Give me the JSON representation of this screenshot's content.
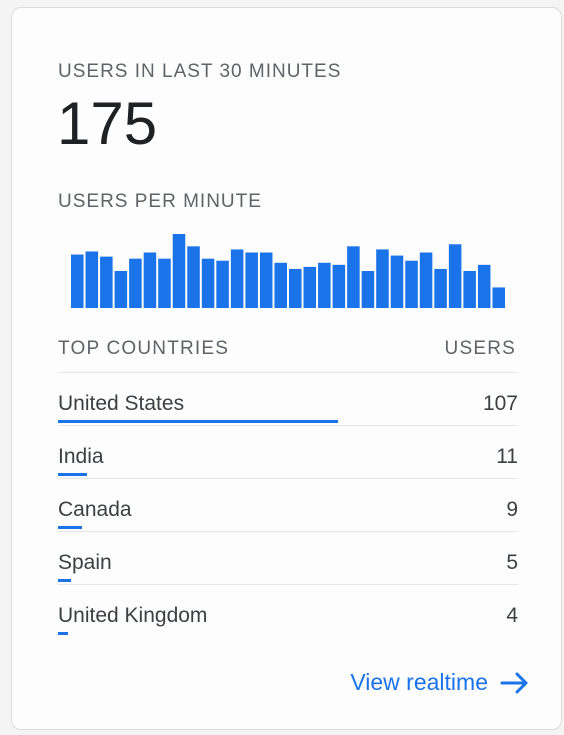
{
  "users_heading": "USERS IN LAST 30 MINUTES",
  "users_total": "175",
  "per_minute_heading": "USERS PER MINUTE",
  "chart_data": {
    "type": "bar",
    "xlabel": "",
    "ylabel": "",
    "values": [
      52,
      55,
      50,
      36,
      48,
      54,
      48,
      72,
      60,
      48,
      46,
      57,
      54,
      54,
      44,
      38,
      40,
      44,
      42,
      60,
      36,
      57,
      51,
      46,
      54,
      38,
      62,
      36,
      42,
      20
    ],
    "color": "#1a73e8"
  },
  "table": {
    "col_left": "TOP COUNTRIES",
    "col_right": "USERS",
    "max": 107,
    "rows": [
      {
        "country": "United States",
        "users": "107",
        "value": 107
      },
      {
        "country": "India",
        "users": "11",
        "value": 11
      },
      {
        "country": "Canada",
        "users": "9",
        "value": 9
      },
      {
        "country": "Spain",
        "users": "5",
        "value": 5
      },
      {
        "country": "United Kingdom",
        "users": "4",
        "value": 4
      }
    ]
  },
  "link": {
    "label": "View realtime",
    "icon": "arrow-right-icon"
  },
  "colors": {
    "accent": "#1a73e8",
    "text": "#3c4043",
    "muted": "#5f6368"
  }
}
